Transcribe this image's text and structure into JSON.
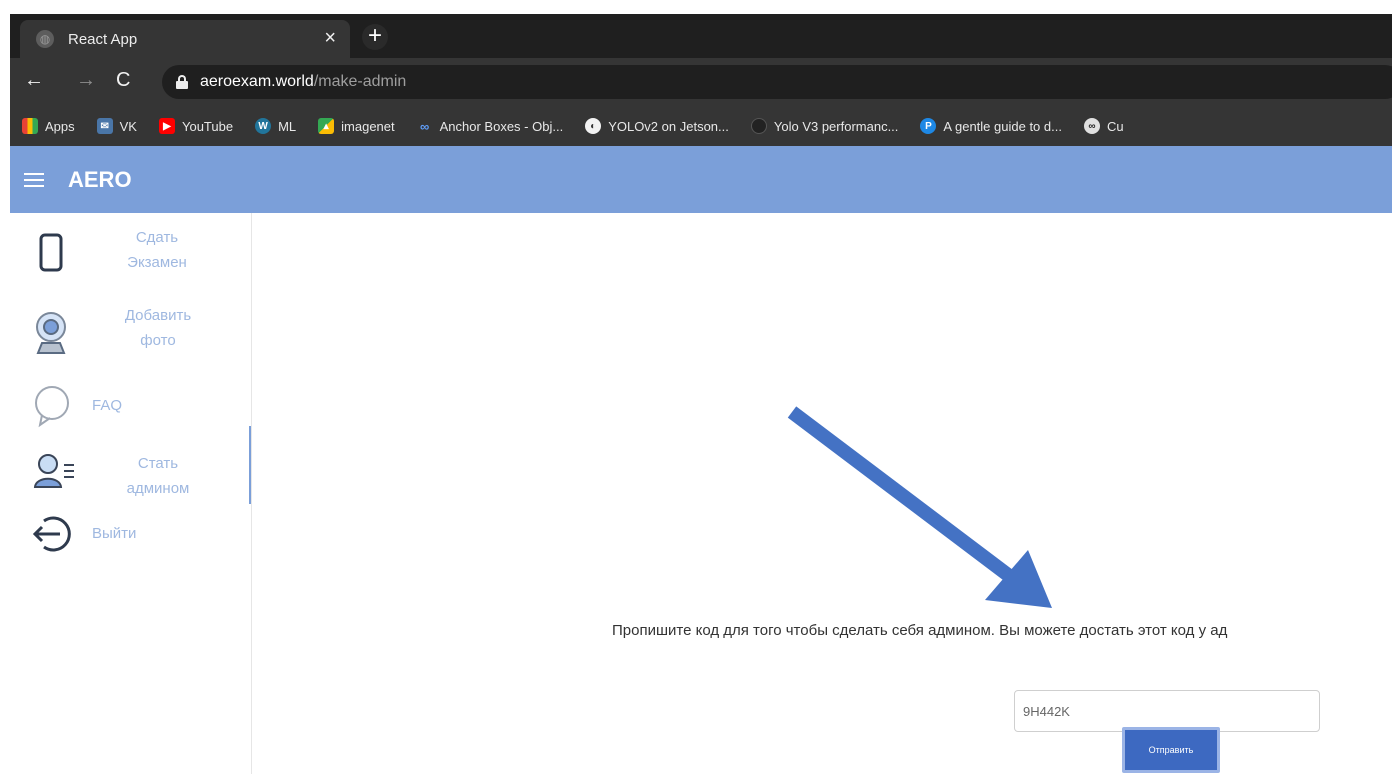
{
  "browser": {
    "tab_title": "React App",
    "url_host": "aeroexam.world",
    "url_path": "/make-admin",
    "bookmarks": [
      {
        "label": "Apps",
        "icon": "apps-grid-icon",
        "color": "#e94235"
      },
      {
        "label": "VK",
        "icon": "vk-icon",
        "color": "#4a76a8"
      },
      {
        "label": "YouTube",
        "icon": "youtube-icon",
        "color": "#ff0000"
      },
      {
        "label": "ML",
        "icon": "wordpress-icon",
        "color": "#21759b"
      },
      {
        "label": "imagenet",
        "icon": "imagenet-icon",
        "color": "#34a853"
      },
      {
        "label": "Anchor Boxes - Obj...",
        "icon": "infinity-icon",
        "color": "#5f9df7"
      },
      {
        "label": "YOLOv2 on Jetson...",
        "icon": "globe-icon",
        "color": "#444444"
      },
      {
        "label": "Yolo V3 performanc...",
        "icon": "github-icon",
        "color": "#222222"
      },
      {
        "label": "A gentle guide to d...",
        "icon": "p-icon",
        "color": "#1e88e5"
      },
      {
        "label": "Cu",
        "icon": "cu-icon",
        "color": "#e0e0e0"
      }
    ]
  },
  "app": {
    "title": "AERO",
    "accent_color": "#7b9fd9",
    "sidebar": {
      "items": [
        {
          "line1": "Сдать",
          "line2": "Экзамен",
          "icon": "phone-icon"
        },
        {
          "line1": "Добавить",
          "line2": "фото",
          "icon": "webcam-icon"
        },
        {
          "line1": "FAQ",
          "line2": "",
          "icon": "chat-bubble-icon"
        },
        {
          "line1": "Стать",
          "line2": "админом",
          "icon": "admin-user-icon",
          "active": true
        },
        {
          "line1": "Выйти",
          "line2": "",
          "icon": "logout-icon"
        }
      ]
    }
  },
  "main": {
    "instruction": "Пропишите код для того чтобы сделать себя админом. Вы можете достать этот код у ад",
    "code_value": "9H442K",
    "submit_label": "Отправить"
  }
}
